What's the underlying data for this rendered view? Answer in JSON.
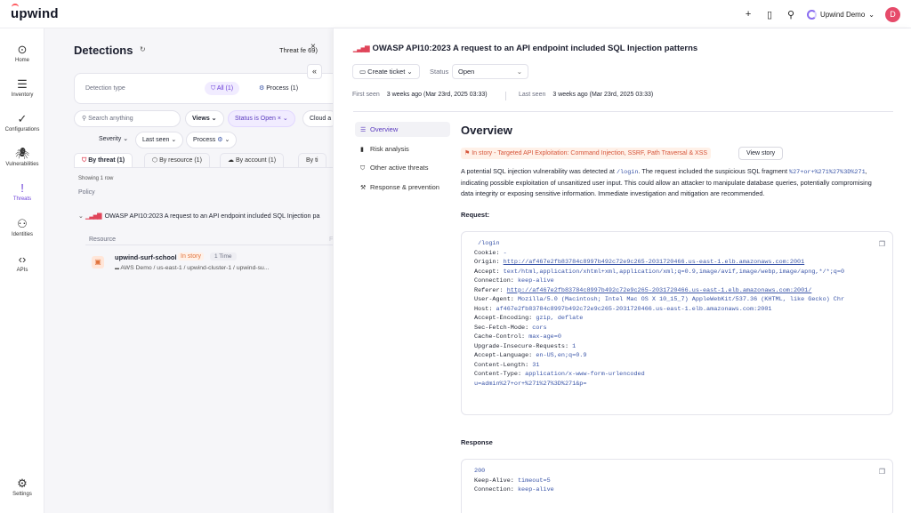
{
  "topbar": {
    "logo": "upwind",
    "org_name": "Upwind Demo",
    "avatar_initial": "D",
    "icons": [
      "plus-icon",
      "book-icon",
      "person-icon",
      "org-ring-icon",
      "chevron-down-icon"
    ]
  },
  "leftnav": {
    "items": [
      {
        "label": "Home",
        "icon": "⊙"
      },
      {
        "label": "Inventory",
        "icon": "☰"
      },
      {
        "label": "Configurations",
        "icon": "✓"
      },
      {
        "label": "Vulnerabilities",
        "icon": "🕷"
      },
      {
        "label": "Threats",
        "icon": "!"
      },
      {
        "label": "Identities",
        "icon": "⚇"
      },
      {
        "label": "APIs",
        "icon": "‹›"
      },
      {
        "label": "Settings",
        "icon": "⚙"
      }
    ]
  },
  "detections": {
    "title": "Detections",
    "threat_feed": "Threat fe",
    "threat_feed_count": "69)",
    "detection_type_label": "Detection type",
    "chip_all": "All (1)",
    "chip_process": "Process (1)",
    "search_placeholder": "Search anything",
    "views": "Views",
    "status_filter": "Status is Open",
    "cloud_filter": "Cloud a",
    "severity": "Severity",
    "last_seen": "Last seen",
    "process": "Process",
    "tabs": [
      "By threat (1)",
      "By resource (1)",
      "By account (1)",
      "By ti"
    ],
    "showing": "Showing 1 row",
    "policy_header": "Policy",
    "row_title": "OWASP API10:2023 A request to an API endpoint included SQL Injection pa",
    "resource_header": "Resource",
    "resource_divider": "F",
    "resource_name": "upwind-surf-school",
    "in_story": "In story",
    "one_time": "1 Time",
    "resource_path": "AWS Demo / us-east-1 / upwind-cluster-1 / upwind-su..."
  },
  "detail": {
    "close": "×",
    "collapse": "«",
    "title": "OWASP API10:2023 A request to an API endpoint included SQL Injection patterns",
    "create_ticket": "Create ticket",
    "status_label": "Status",
    "status_value": "Open",
    "first_seen_label": "First seen",
    "first_seen_value": "3 weeks ago (Mar 23rd, 2025 03:33)",
    "last_seen_label": "Last seen",
    "last_seen_value": "3 weeks ago (Mar 23rd, 2025 03:33)",
    "nav": [
      "Overview",
      "Risk analysis",
      "Other active threats",
      "Response & prevention"
    ],
    "overview_title": "Overview",
    "story_tag": "In story - Targeted API Exploitation: Command Injection, SSRF, Path Traversal & XSS",
    "view_story": "View story",
    "desc_1": "A potential SQL injection vulnerability was detected at",
    "desc_path": "/login",
    "desc_2": ". The request included the suspicious SQL fragment",
    "desc_fragment": "%27+or+%271%27%3D%271",
    "desc_3": ", indicating possible exploitation of unsanitized user input. This could allow an attacker to manipulate database queries, potentially compromising data integrity or exposing sensitive information. Immediate investigation and mitigation are recommended.",
    "request_label": "Request:",
    "request_lines": [
      {
        "k": "",
        "v": " /login"
      },
      {
        "k": "Cookie: ",
        "v": "-"
      },
      {
        "k": "Origin: ",
        "v": "http://af467e2fb83784c8997b492c72e9c265-2031720466.us-east-1.elb.amazonaws.com:2001",
        "u": true
      },
      {
        "k": "Accept: ",
        "v": "text/html,application/xhtml+xml,application/xml;q=0.9,image/avif,image/webp,image/apng,*/*;q=0"
      },
      {
        "k": "Connection: ",
        "v": "keep-alive"
      },
      {
        "k": "Referer: ",
        "v": "http://af467e2fb83784c8997b492c72e9c265-2031720466.us-east-1.elb.amazonaws.com:2001/",
        "u": true
      },
      {
        "k": "User-Agent: ",
        "v": "Mozilla/5.0 (Macintosh; Intel Mac OS X 10_15_7) AppleWebKit/537.36 (KHTML, like Gecko) Chr"
      },
      {
        "k": "Host: ",
        "v": "af467e2fb83784c8997b492c72e9c265-2031720466.us-east-1.elb.amazonaws.com:2001"
      },
      {
        "k": "Accept-Encoding: ",
        "v": "gzip, deflate"
      },
      {
        "k": "Sec-Fetch-Mode: ",
        "v": "cors"
      },
      {
        "k": "Cache-Control: ",
        "v": "max-age=0"
      },
      {
        "k": "Upgrade-Insecure-Requests: ",
        "v": "1"
      },
      {
        "k": "Accept-Language: ",
        "v": "en-US,en;q=0.9"
      },
      {
        "k": "Content-Length: ",
        "v": "31"
      },
      {
        "k": "Content-Type: ",
        "v": "application/x-www-form-urlencoded"
      },
      {
        "k": "",
        "v": "u=admin%27+or+%271%27%3D%271&p="
      }
    ],
    "response_label": "Response",
    "response_lines": [
      {
        "k": "",
        "v": "200"
      },
      {
        "k": "Keep-Alive: ",
        "v": "timeout=5"
      },
      {
        "k": "Connection: ",
        "v": "keep-alive"
      }
    ]
  },
  "colors": {
    "accent": "#6b3fd8",
    "danger": "#e0455a",
    "story": "#e0733d",
    "code_value": "#3a55a8"
  }
}
